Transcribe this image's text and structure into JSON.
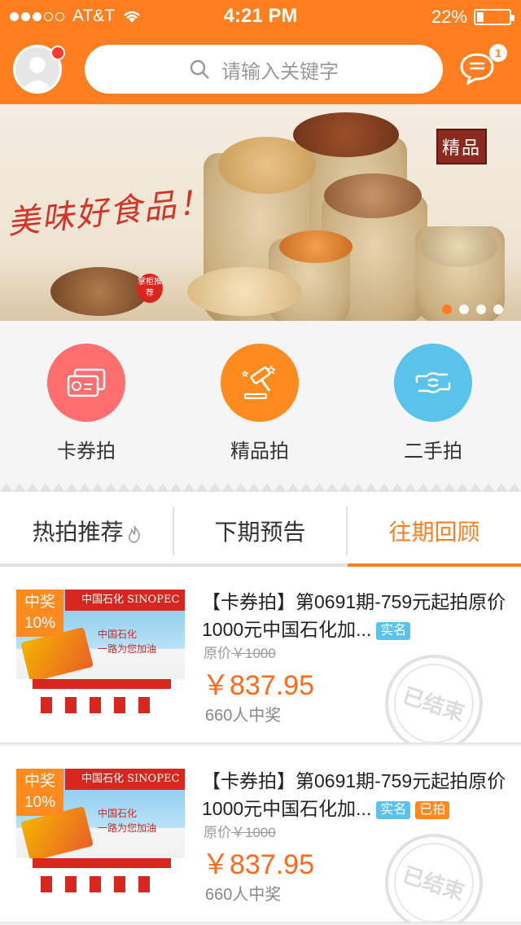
{
  "status_bar": {
    "carrier": "AT&T",
    "time": "4:21 PM",
    "battery": "22%",
    "battery_level": 0.22
  },
  "header": {
    "search_placeholder": "请输入关键字",
    "message_count": "1",
    "accent_color": "#ff7e1f"
  },
  "banner": {
    "headline": "美味好食品！",
    "seal": "精品",
    "tag": "掌柜推荐",
    "slide_count": 4,
    "active_slide": 1
  },
  "categories": [
    {
      "label": "卡券拍",
      "icon": "card-icon",
      "color": "#ff6e6e"
    },
    {
      "label": "精品拍",
      "icon": "gavel-icon",
      "color": "#ff8a1e"
    },
    {
      "label": "二手拍",
      "icon": "handshake-icon",
      "color": "#59c3ec"
    }
  ],
  "tabs": [
    {
      "label": "热拍推荐",
      "icon": "flame-icon"
    },
    {
      "label": "下期预告"
    },
    {
      "label": "往期回顾",
      "active": true
    }
  ],
  "items": [
    {
      "prize_label": "中奖",
      "prize_rate": "10%",
      "thumb_brand": "中国石化  SINOPEC",
      "thumb_slogan_1": "中国石化",
      "thumb_slogan_2": "一路为您加油",
      "title": "【卡券拍】第0691期-759元起拍原价1000元中国石化加...",
      "badges": [
        "实名"
      ],
      "orig_price_label": "原价",
      "orig_price": "￥1000",
      "price": "￥837.95",
      "winners": "660人中奖",
      "stamp": "已结束"
    },
    {
      "prize_label": "中奖",
      "prize_rate": "10%",
      "thumb_brand": "中国石化  SINOPEC",
      "thumb_slogan_1": "中国石化",
      "thumb_slogan_2": "一路为您加油",
      "title": "【卡券拍】第0691期-759元起拍原价1000元中国石化加...",
      "badges": [
        "实名",
        "已拍"
      ],
      "orig_price_label": "原价",
      "orig_price": "￥1000",
      "price": "￥837.95",
      "winners": "660人中奖",
      "stamp": "已结束"
    }
  ]
}
